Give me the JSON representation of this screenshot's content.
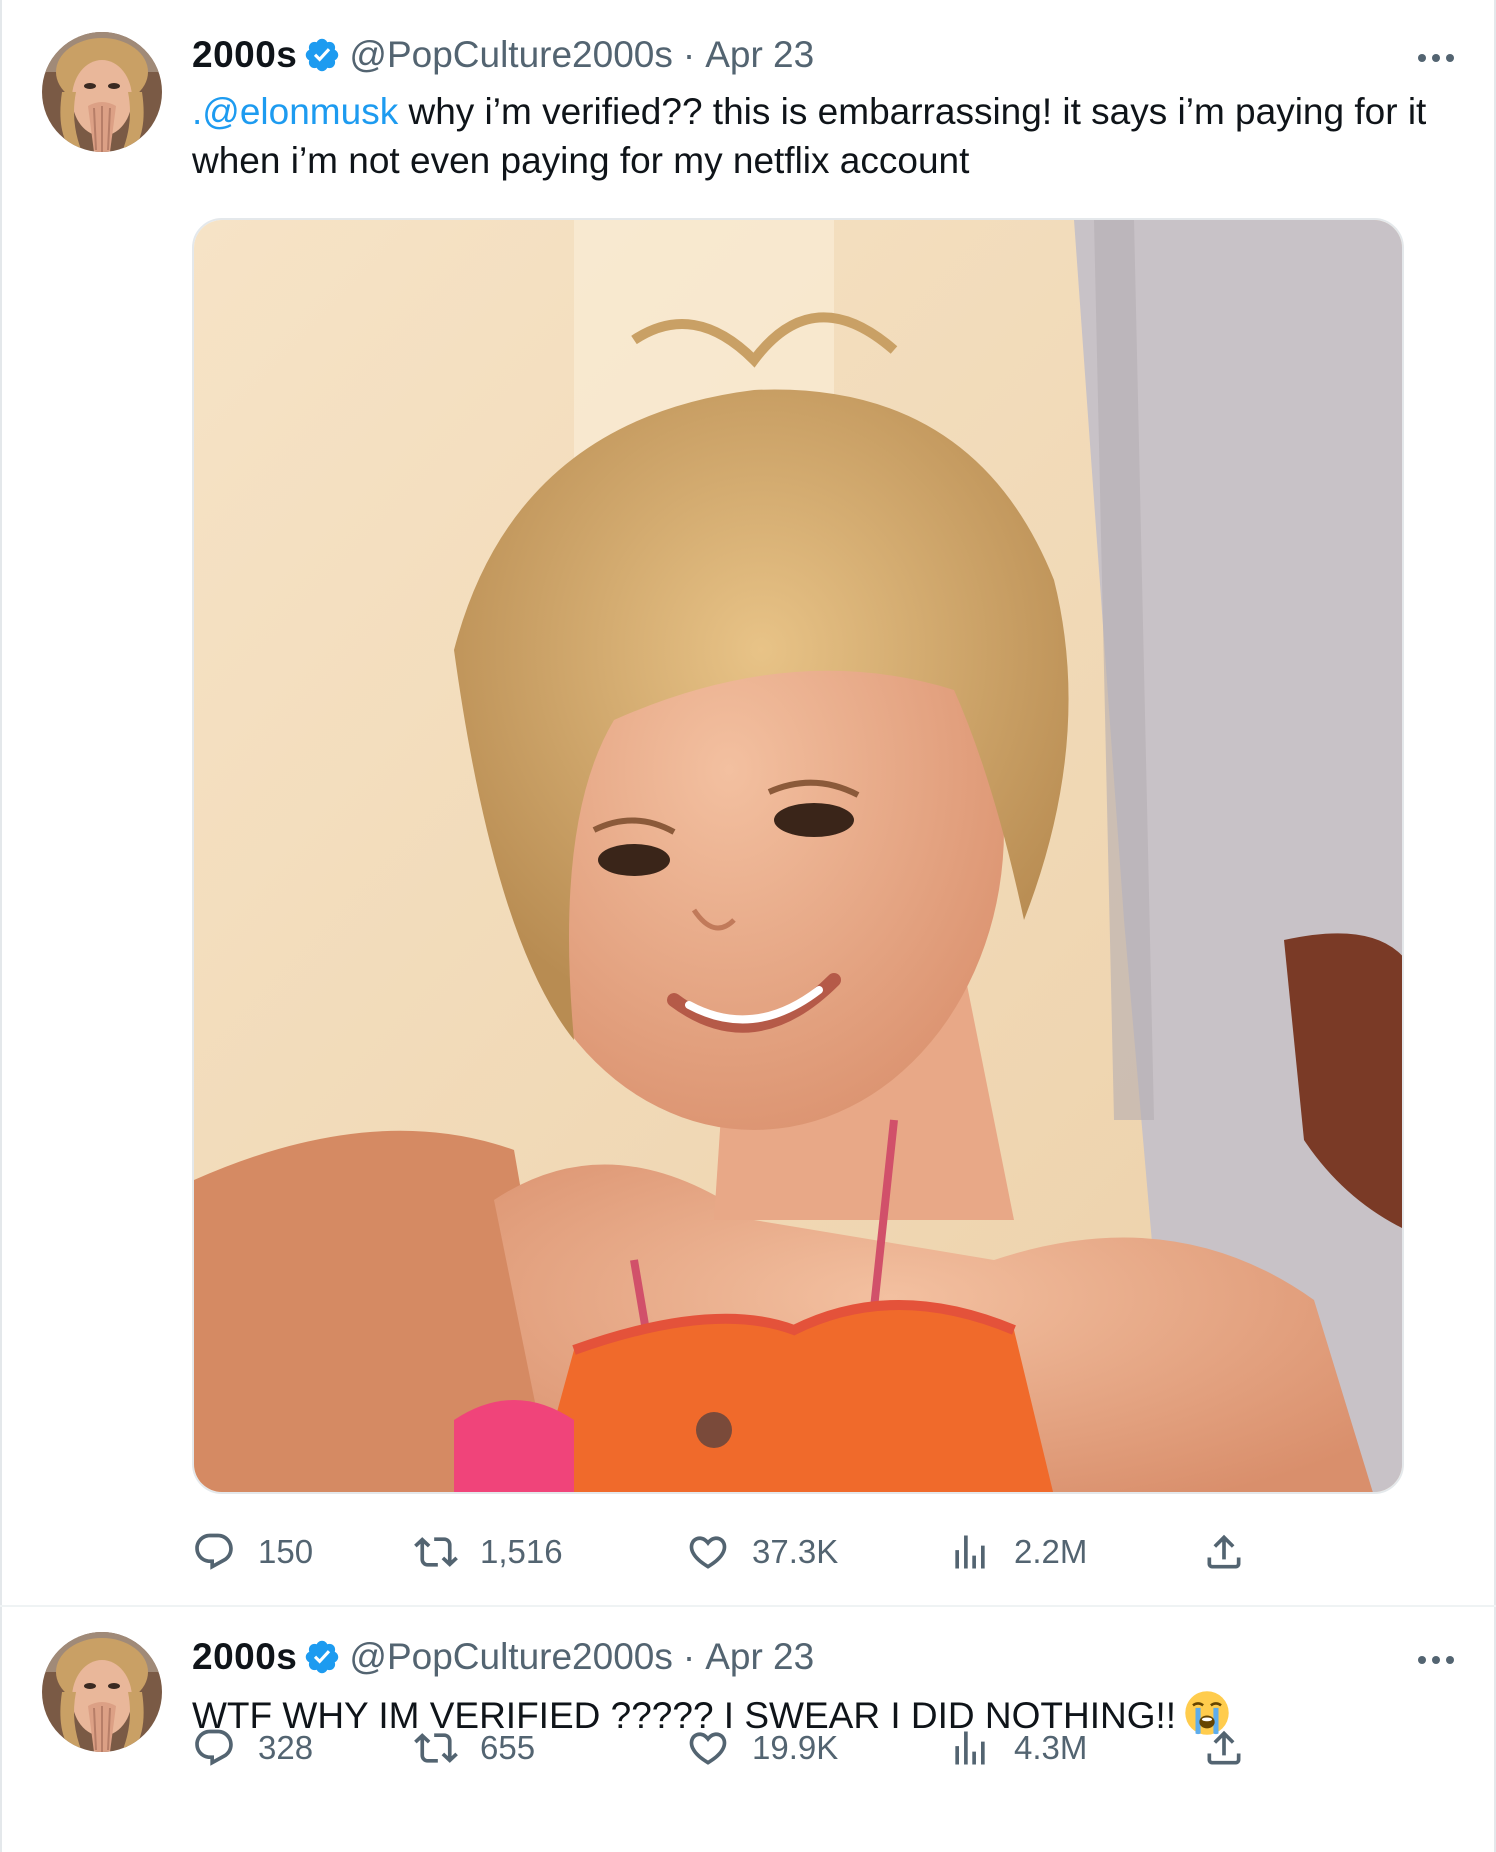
{
  "tweets": [
    {
      "author": {
        "name": "2000s",
        "handle": "@PopCulture2000s",
        "verified": true,
        "avatar": "avatar-woman-hands-over-mouth"
      },
      "separator": "·",
      "date": "Apr 23",
      "text": {
        "mention": ".@elonmusk",
        "body": " why i’m verified?? this is embarrassing! it says i’m paying for it when i’m not even paying for my netflix account"
      },
      "media": {
        "type": "photo",
        "description_icon": "photo-woman-smiling"
      },
      "stats": {
        "replies": "150",
        "retweets": "1,516",
        "likes": "37.3K",
        "views": "2.2M"
      }
    },
    {
      "author": {
        "name": "2000s",
        "handle": "@PopCulture2000s",
        "verified": true,
        "avatar": "avatar-woman-hands-over-mouth"
      },
      "separator": "·",
      "date": "Apr 23",
      "text": {
        "body": "WTF WHY IM VERIFIED ????? I SWEAR I DID NOTHING!!",
        "emoji": "loudly-crying-face-icon"
      },
      "stats": {
        "replies": "328",
        "retweets": "655",
        "likes": "19.9K",
        "views": "4.3M"
      }
    }
  ],
  "colors": {
    "accent": "#1d9bf0",
    "muted": "#536471",
    "text": "#0f1419",
    "border": "#e4e8eb"
  }
}
